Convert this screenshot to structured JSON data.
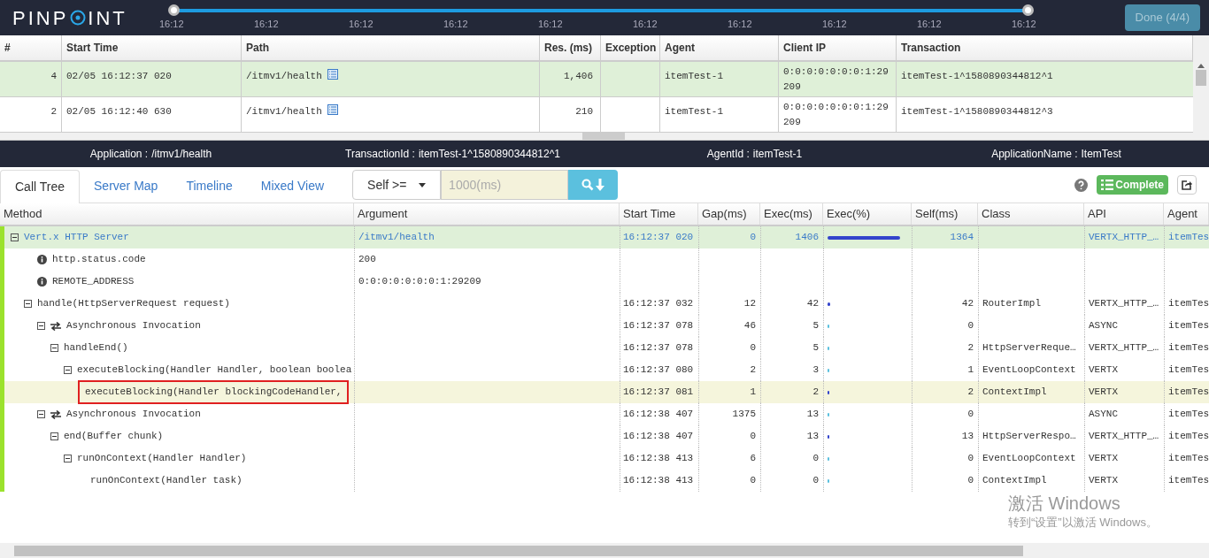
{
  "header": {
    "logo_left": "PINP",
    "logo_right": "INT",
    "timeline": {
      "handles": [
        {
          "level": 0
        },
        {
          "level": 1
        }
      ],
      "ticks": [
        "16:12",
        "16:12",
        "16:12",
        "16:12",
        "16:12",
        "16:12",
        "16:12",
        "16:12",
        "16:12",
        "16:12"
      ]
    },
    "done_button": "Done (4/4)"
  },
  "transactions": {
    "columns": [
      "#",
      "Start Time",
      "Path",
      "Res. (ms)",
      "Exception",
      "Agent",
      "Client IP",
      "Transaction"
    ],
    "rows": [
      {
        "selected": true,
        "num": "4",
        "start_time": "02/05 16:12:37 020",
        "path": "/itmv1/health",
        "res": "1,406",
        "agent": "itemTest-1",
        "client_ip": "0:0:0:0:0:0:0:1:29209",
        "transaction": "itemTest-1^1580890344812^1"
      },
      {
        "selected": false,
        "num": "2",
        "start_time": "02/05 16:12:40 630",
        "path": "/itmv1/health",
        "res": "210",
        "agent": "itemTest-1",
        "client_ip": "0:0:0:0:0:0:0:1:29209",
        "transaction": "itemTest-1^1580890344812^3"
      }
    ]
  },
  "info_bar": [
    {
      "label": "Application :",
      "value": "/itmv1/health"
    },
    {
      "label": "TransactionId :",
      "value": "itemTest-1^1580890344812^1"
    },
    {
      "label": "AgentId :",
      "value": "itemTest-1"
    },
    {
      "label": "ApplicationName :",
      "value": "ItemTest"
    }
  ],
  "tabs": [
    {
      "label": "Call Tree",
      "selected": true
    },
    {
      "label": "Server Map",
      "selected": false
    },
    {
      "label": "Timeline",
      "selected": false
    },
    {
      "label": "Mixed View",
      "selected": false
    }
  ],
  "filter": {
    "select": "Self >=",
    "placeholder": "1000(ms)"
  },
  "complete_button": "Complete",
  "call_tree": {
    "columns": [
      "Method",
      "Argument",
      "Start Time",
      "Gap(ms)",
      "Exec(ms)",
      "Exec(%)",
      "Self(ms)",
      "Class",
      "API",
      "Agent"
    ],
    "rows": [
      {
        "kind": "method",
        "text": "Vert.x HTTP Server",
        "expanded": true,
        "selected": true,
        "flagged": false,
        "argument": "/itmv1/health",
        "start_time": "16:12:37 020",
        "gap": "0",
        "exec": "1406",
        "level": 0.9,
        "color": "#3344cc",
        "self": "1364",
        "api": "VERTX_HTTP_…",
        "agent": "itemTes",
        "children": [
          {
            "kind": "info",
            "text": "http.status.code",
            "argument": "200",
            "selected": false,
            "flagged": false
          },
          {
            "kind": "info",
            "text": "REMOTE_ADDRESS",
            "argument": "0:0:0:0:0:0:0:1:29209",
            "selected": false,
            "flagged": false
          },
          {
            "kind": "method",
            "text": "handle(HttpServerRequest request)",
            "expanded": true,
            "selected": false,
            "flagged": false,
            "start_time": "16:12:37 032",
            "gap": "12",
            "exec": "42",
            "level": 0.03,
            "color": "#3344cc",
            "self": "42",
            "class": "RouterImpl",
            "api": "VERTX_HTTP_…",
            "agent": "itemTes",
            "children": [
              {
                "kind": "async",
                "text": "Asynchronous Invocation",
                "expanded": true,
                "selected": false,
                "flagged": false,
                "start_time": "16:12:37 078",
                "gap": "46",
                "exec": "5",
                "level": 0.01,
                "color": "#5bc0de",
                "self": "0",
                "api": "ASYNC",
                "agent": "itemTes",
                "children": [
                  {
                    "kind": "method",
                    "text": "handleEnd()",
                    "expanded": true,
                    "selected": false,
                    "flagged": false,
                    "start_time": "16:12:37 078",
                    "gap": "0",
                    "exec": "5",
                    "level": 0.01,
                    "color": "#5bc0de",
                    "self": "2",
                    "class": "HttpServerReque…",
                    "api": "VERTX_HTTP_…",
                    "agent": "itemTes",
                    "children": [
                      {
                        "kind": "method",
                        "text": "executeBlocking(Handler Handler, boolean boolea",
                        "expanded": true,
                        "selected": false,
                        "flagged": false,
                        "start_time": "16:12:37 080",
                        "gap": "2",
                        "exec": "3",
                        "level": 0.01,
                        "color": "#5bc0de",
                        "self": "1",
                        "class": "EventLoopContext",
                        "api": "VERTX",
                        "agent": "itemTes",
                        "children": [
                          {
                            "kind": "method",
                            "text": "executeBlocking(Handler blockingCodeHandler,",
                            "selected": false,
                            "flagged": true,
                            "start_time": "16:12:37 081",
                            "gap": "1",
                            "exec": "2",
                            "level": 0.01,
                            "color": "#3344cc",
                            "self": "2",
                            "class": "ContextImpl",
                            "api": "VERTX",
                            "agent": "itemTes"
                          }
                        ]
                      }
                    ]
                  }
                ]
              },
              {
                "kind": "async",
                "text": "Asynchronous Invocation",
                "expanded": true,
                "selected": false,
                "flagged": false,
                "start_time": "16:12:38 407",
                "gap": "1375",
                "exec": "13",
                "level": 0.02,
                "color": "#5bc0de",
                "self": "0",
                "api": "ASYNC",
                "agent": "itemTes",
                "children": [
                  {
                    "kind": "method",
                    "text": "end(Buffer chunk)",
                    "expanded": true,
                    "selected": false,
                    "flagged": false,
                    "start_time": "16:12:38 407",
                    "gap": "0",
                    "exec": "13",
                    "level": 0.02,
                    "color": "#3344cc",
                    "self": "13",
                    "class": "HttpServerRespo…",
                    "api": "VERTX_HTTP_…",
                    "agent": "itemTes",
                    "children": [
                      {
                        "kind": "method",
                        "text": "runOnContext(Handler Handler)",
                        "expanded": true,
                        "selected": false,
                        "flagged": false,
                        "start_time": "16:12:38 413",
                        "gap": "6",
                        "exec": "0",
                        "level": 0.01,
                        "color": "#5bc0de",
                        "self": "0",
                        "class": "EventLoopContext",
                        "api": "VERTX",
                        "agent": "itemTes",
                        "children": [
                          {
                            "kind": "method",
                            "text": "runOnContext(Handler task)",
                            "selected": false,
                            "flagged": false,
                            "start_time": "16:12:38 413",
                            "gap": "0",
                            "exec": "0",
                            "level": 0.01,
                            "color": "#5bc0de",
                            "self": "0",
                            "class": "ContextImpl",
                            "api": "VERTX",
                            "agent": "itemTes"
                          }
                        ]
                      }
                    ]
                  }
                ]
              }
            ]
          }
        ]
      }
    ]
  },
  "os_overlay": {
    "title": "激活 Windows",
    "subtitle": "转到“设置”以激活 Windows。"
  }
}
